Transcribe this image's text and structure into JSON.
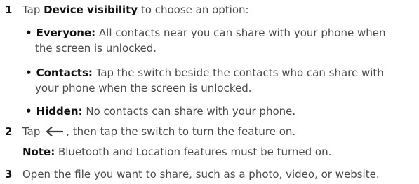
{
  "steps": [
    {
      "number": "1",
      "pre": "Tap ",
      "bold": "Device visibility",
      "post": " to choose an option:"
    },
    {
      "number": "2",
      "pre": "Tap ",
      "post": ", then tap the switch to turn the feature on."
    },
    {
      "number": "3",
      "text": "Open the file you want to share, such as a photo, video, or website."
    }
  ],
  "options": [
    {
      "bold": "Everyone:",
      "line1": " All contacts near you can share with your phone when",
      "line2": "the screen is unlocked."
    },
    {
      "bold": "Contacts:",
      "line1": " Tap the switch beside the contacts who can share with",
      "line2": "your phone when the screen is unlocked."
    },
    {
      "bold": "Hidden:",
      "line1": " No contacts can share with your phone."
    }
  ],
  "bullet_glyph": "•",
  "note": {
    "bold": "Note:",
    "text": " Bluetooth and Location features must be turned on."
  },
  "icons": {
    "back_arrow": "back-arrow-icon"
  }
}
